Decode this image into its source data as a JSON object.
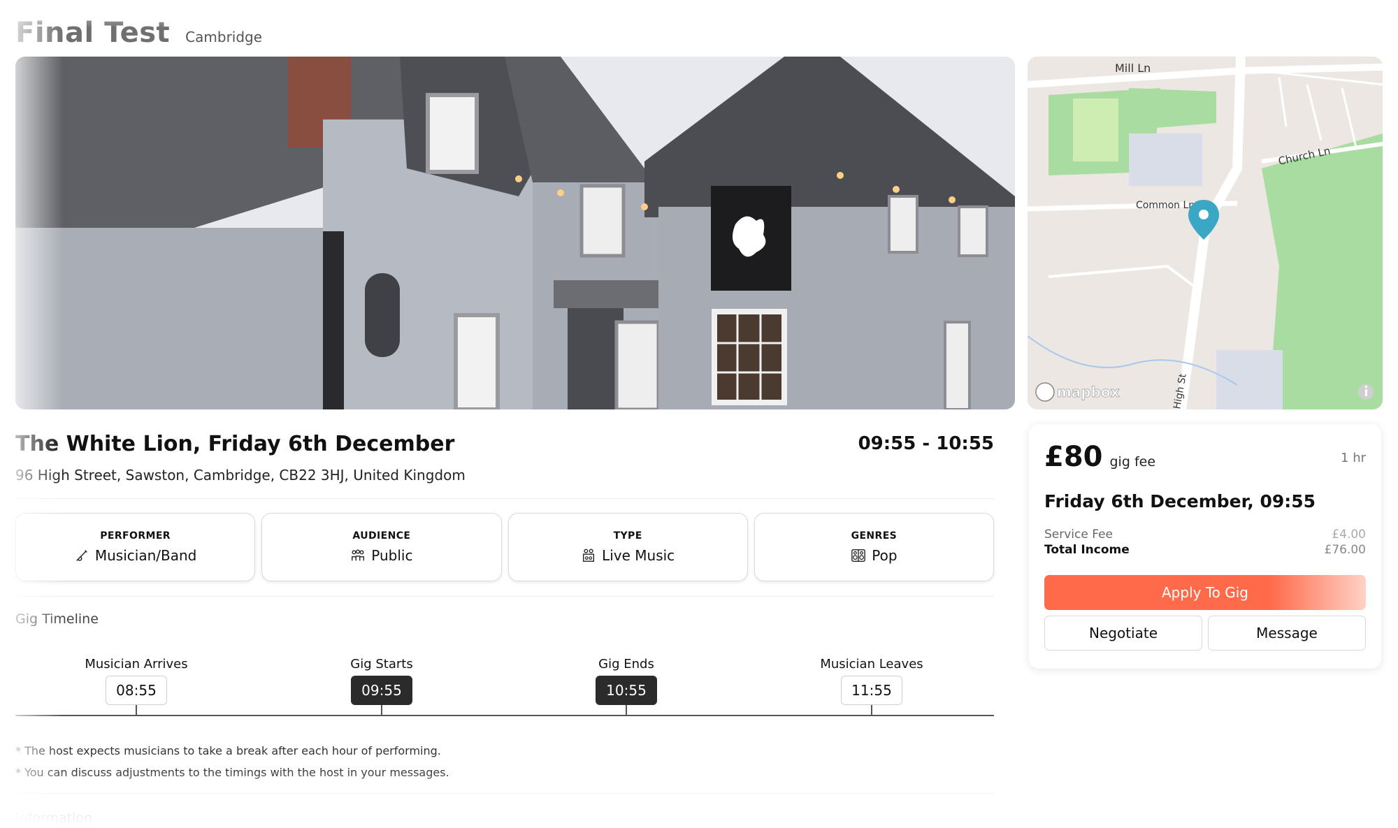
{
  "header": {
    "title": "Final Test",
    "location": "Cambridge"
  },
  "map": {
    "labels": {
      "mill_ln": "Mill Ln",
      "church_ln": "Church Ln",
      "common_ln": "Common Ln",
      "high_st": "High St"
    },
    "attribution": "mapbox",
    "marker_color": "#3aa7c4"
  },
  "gig": {
    "title": "The White Lion, Friday 6th December",
    "time_range": "09:55 - 10:55",
    "address": "96 High Street, Sawston, Cambridge, CB22 3HJ, United Kingdom"
  },
  "details": [
    {
      "label": "PERFORMER",
      "value": "Musician/Band",
      "icon": "guitar-icon"
    },
    {
      "label": "AUDIENCE",
      "value": "Public",
      "icon": "people-icon"
    },
    {
      "label": "TYPE",
      "value": "Live Music",
      "icon": "musicians-icon"
    },
    {
      "label": "GENRES",
      "value": "Pop",
      "icon": "speaker-icon"
    }
  ],
  "timeline": {
    "heading": "Gig Timeline",
    "items": [
      {
        "label": "Musician Arrives",
        "time": "08:55"
      },
      {
        "label": "Gig Starts",
        "time": "09:55"
      },
      {
        "label": "Gig Ends",
        "time": "10:55"
      },
      {
        "label": "Musician Leaves",
        "time": "11:55"
      }
    ],
    "notes": [
      "* The host expects musicians to take a break after each hour of performing.",
      "* You can discuss adjustments to the timings with the host in your messages."
    ]
  },
  "next_section": "Information",
  "booking": {
    "price": "£80",
    "price_unit": "gig fee",
    "duration": "1 hr",
    "date_time": "Friday 6th December, 09:55",
    "service_fee_label": "Service Fee",
    "service_fee_value": "£4.00",
    "total_label": "Total Income",
    "total_value": "£76.00",
    "apply_label": "Apply To Gig",
    "negotiate_label": "Negotiate",
    "message_label": "Message"
  },
  "colors": {
    "accent": "#ff6a4a",
    "dark_chip": "#2b2b2b"
  }
}
